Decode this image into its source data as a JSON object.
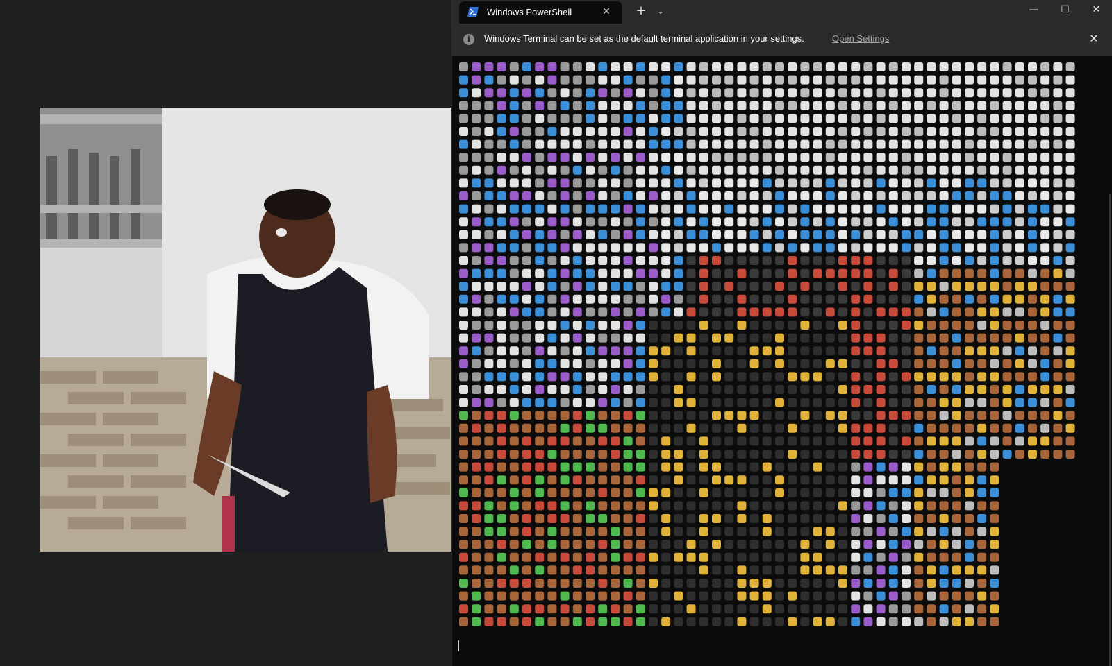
{
  "window": {
    "tab_title": "Windows PowerShell",
    "tab_icon": "powershell-icon",
    "new_tab_icon": "plus-icon",
    "dropdown_icon": "chevron-down-icon",
    "minimize_icon": "minimize-icon",
    "maximize_icon": "maximize-icon",
    "close_icon": "close-icon"
  },
  "infobar": {
    "icon": "info-icon",
    "message": "Windows Terminal can be set as the default terminal application in your settings.",
    "link": "Open Settings",
    "close_icon": "close-icon"
  },
  "terminal": {
    "content": "emoji-art rendering of the video frame (grid of colored emoji)",
    "palette": {
      "background": "#0c0c0c",
      "skin": "#a8653a",
      "skin_dark": "#6b3a22",
      "shirt_white": "#e8e8e8",
      "apron_black": "#1b1b1b",
      "brick_red": "#c84a3a",
      "wall_grey": "#bdbdbd",
      "wall_light": "#e2e2e2",
      "sky_blue": "#3a8fd8",
      "gold": "#e0b23a",
      "green": "#4fb84f",
      "purple": "#9a5cc8"
    }
  },
  "video": {
    "colors": {
      "wall": "#d4d4d4",
      "brick": "#a89a86",
      "shirt": "#f2f2f2",
      "apron": "#1c1c24",
      "skin": "#5a3424"
    }
  }
}
